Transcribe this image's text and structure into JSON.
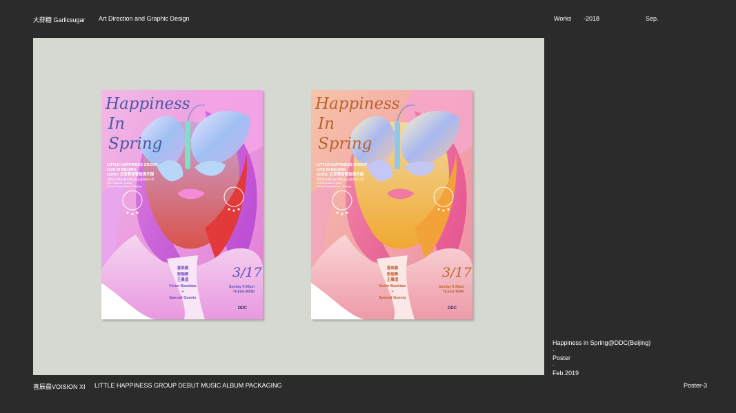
{
  "header": {
    "brand": "大蒜糖 Garlicsugar",
    "subtitle": "Art Direction and Graphic Design",
    "nav_works": "Works",
    "nav_year": "-2018",
    "nav_month": "Sep."
  },
  "poster": {
    "title_lines": [
      "Happiness",
      "In",
      "Spring"
    ],
    "info_lines": [
      "LITTLE HAPPINESS GROUP",
      "LIVE IN BEIJING",
      "@DDC 北京黄昏管弦俱乐部"
    ],
    "address_lines": [
      "北京市东城区美术馆后街山老胡同18号",
      "24# Shaolao Hutong,",
      "Dong Cheng District, Beijing"
    ],
    "names": [
      "喜辰晨",
      "张珈昊",
      "王晨渲",
      "Victor Bastidas",
      "+",
      "Special Guests"
    ],
    "date": "3/17",
    "time_lines": [
      "Sunday 9:30pm",
      "Tickets:60/80"
    ],
    "logo": "DDC"
  },
  "colors": {
    "background": "#2b2b2b",
    "canvas": "#d6d9d1",
    "poster1_title": "#4b57a6",
    "poster2_title": "#b8622e"
  },
  "project": {
    "title": "Happiness in Spring@DDC(Beijing)",
    "sep": "-",
    "type": "Poster",
    "date": "Feb.2019"
  },
  "footer": {
    "left": "喜辰晨VOISION XI",
    "middle": "LITTLE HAPPINESS GROUP DEBUT MUSIC ALBUM PACKAGING",
    "right": "Poster-3"
  }
}
